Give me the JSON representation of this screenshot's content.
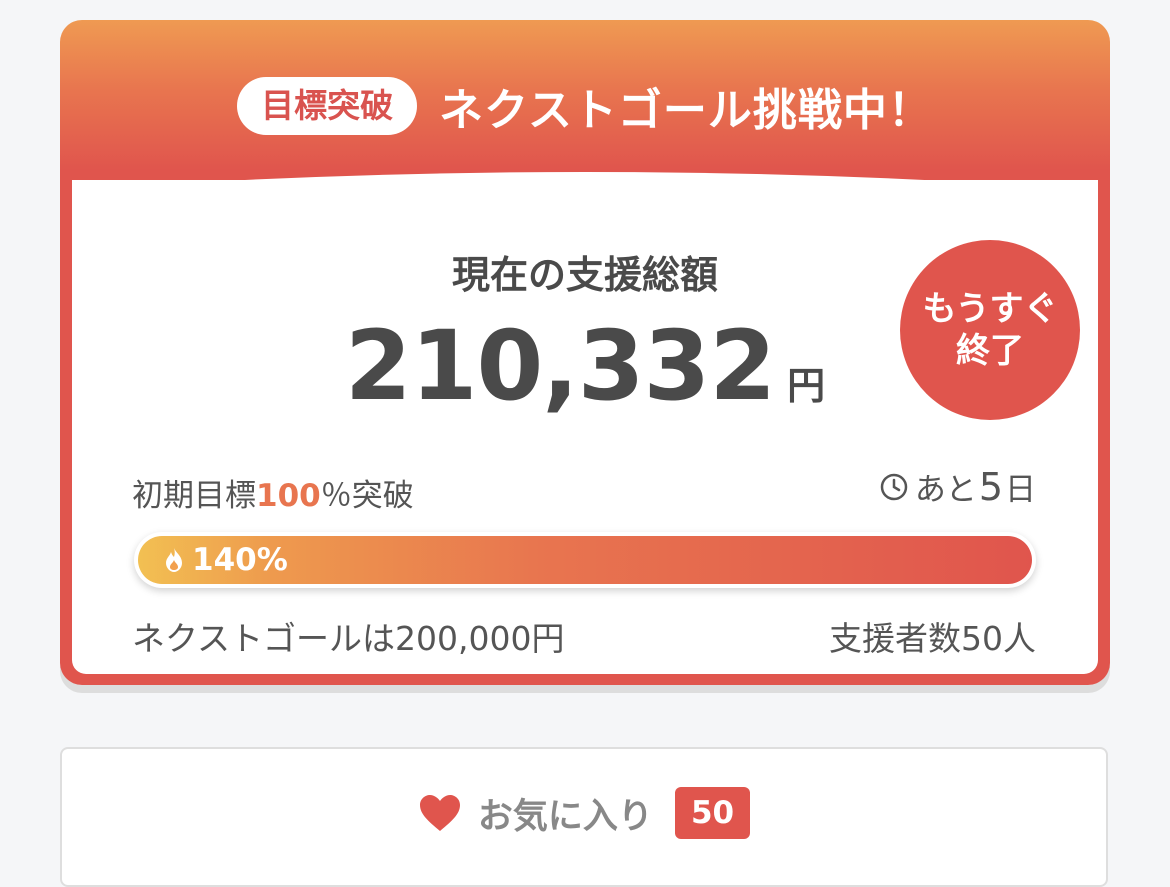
{
  "header": {
    "badge": "目標突破",
    "headline": "ネクストゴール挑戦中！"
  },
  "summary": {
    "label": "現在の支援総額",
    "amount": "210,332",
    "currency": "円",
    "soon_line1": "もうすぐ",
    "soon_line2": "終了",
    "goal_prefix": "初期目標",
    "goal_pct": "100",
    "goal_suffix": "％突破",
    "remaining_prefix": "あと",
    "remaining_days": "5",
    "remaining_suffix": "日",
    "progress_label": "140%",
    "progress_value": 1.4,
    "next_goal": "ネクストゴールは200,000円",
    "supporters": "支援者数50人"
  },
  "favorite": {
    "label": "お気に入り",
    "count": "50"
  },
  "colors": {
    "accent": "#e0554d",
    "orange": "#e8754f",
    "gradient_start": "#f2c052"
  },
  "icons": [
    "clock-icon",
    "flame-icon",
    "heart-icon"
  ]
}
